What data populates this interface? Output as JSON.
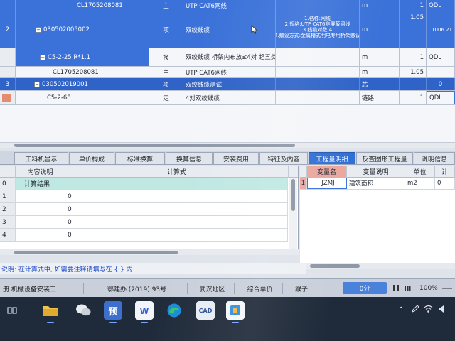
{
  "upper_grid": {
    "rows": [
      {
        "index": "",
        "code": "CL1705208081",
        "kind": "主",
        "name": "UTP CAT6网线",
        "unit": "m",
        "qty": "1",
        "tag": "QDL"
      },
      {
        "index": "2",
        "code": "030502005002",
        "kind": "项",
        "name": "双绞线缆",
        "features": [
          "1.名称:网线",
          "2.规格:UTP CAT6非屏蔽网线",
          "3.线缆对数:4",
          "4.敷设方式:金属槽式明电专用桥架敷设"
        ],
        "unit": "m",
        "qty": "1.05",
        "extra": "1006.21"
      },
      {
        "index": "",
        "code": "C5-2-25 R*1.1",
        "kind": "换",
        "name": "双绞线缆 桥架内布放≤4对 超五类的布线工程 人工*1.1",
        "unit": "m",
        "qty": "1",
        "tag": "QDL"
      },
      {
        "index": "",
        "code": "CL1705208081",
        "kind": "主",
        "name": "UTP CAT6网线",
        "unit": "m",
        "qty": "1.05",
        "tag": ""
      },
      {
        "index": "3",
        "code": "030502019001",
        "kind": "项",
        "name": "双绞线缆测试",
        "unit": "芯",
        "qty": "",
        "extra": "0"
      },
      {
        "index": "",
        "code": "C5-2-68",
        "kind": "定",
        "name": "4对双绞线缆",
        "unit": "链路",
        "qty": "1",
        "tag": "QDL"
      }
    ]
  },
  "tabs": [
    {
      "label": "工料机显示"
    },
    {
      "label": "单价构成"
    },
    {
      "label": "标准换算"
    },
    {
      "label": "换算信息"
    },
    {
      "label": "安装费用"
    },
    {
      "label": "特征及内容"
    },
    {
      "label": "工程量明细",
      "active": true
    },
    {
      "label": "反查图形工程量"
    },
    {
      "label": "说明信息"
    }
  ],
  "calc_table": {
    "headers": [
      "内容说明",
      "计算式"
    ],
    "rows": [
      {
        "index": "0",
        "desc": "计算结果",
        "formula": ""
      },
      {
        "index": "1",
        "desc": "",
        "formula": "0"
      },
      {
        "index": "2",
        "desc": "",
        "formula": "0"
      },
      {
        "index": "3",
        "desc": "",
        "formula": "0"
      },
      {
        "index": "4",
        "desc": "",
        "formula": "0"
      }
    ]
  },
  "var_table": {
    "headers": [
      "变量名",
      "变量说明",
      "单位",
      "计"
    ],
    "rows": [
      {
        "index": "1",
        "name": "JZMJ",
        "desc": "建筑面积",
        "unit": "m2",
        "value": "0"
      }
    ]
  },
  "hint": "说明: 在计算式中, 如需要注释请填写在 { } 内",
  "status": {
    "items": [
      "册 机械设备安装工",
      "鄂建办 (2019) 93号",
      "武汉地区",
      "综合单价",
      "猴子"
    ],
    "zoom_button": "0分",
    "zoom_percent": "100%"
  },
  "colors": {
    "selected_row": "#3b72d9",
    "active_tab": "#2f6fd6",
    "result_row": "#bfe8e3",
    "var_header": "#e9a79f",
    "hint_text": "#1b49c7"
  },
  "taskbar": {
    "apps": [
      {
        "icon": "file-explorer-icon",
        "label": ""
      },
      {
        "icon": "wechat-icon",
        "label": ""
      },
      {
        "icon": "budget-software-icon",
        "label": "预"
      },
      {
        "icon": "wps-icon",
        "label": "W"
      },
      {
        "icon": "edge-icon",
        "label": ""
      },
      {
        "icon": "cad-icon",
        "label": "CAD"
      },
      {
        "icon": "teamviewer-icon",
        "label": ""
      }
    ]
  }
}
